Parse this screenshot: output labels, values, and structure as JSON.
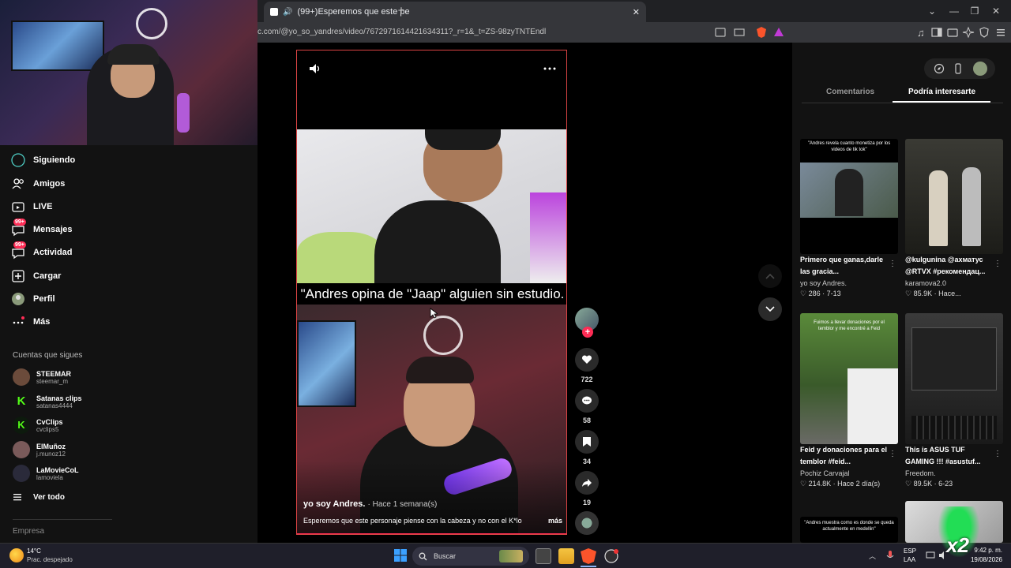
{
  "browser": {
    "tab_title": "(99+)Esperemos que este pe",
    "url": "c.com/@yo_so_yandres/video/7672971614421634311?_r=1&_t=ZS-98zyTNTEndl"
  },
  "sidebar": {
    "nav": [
      {
        "label": "Siguiendo",
        "icon": "following-icon"
      },
      {
        "label": "Amigos",
        "icon": "friends-icon"
      },
      {
        "label": "LIVE",
        "icon": "live-icon"
      },
      {
        "label": "Mensajes",
        "icon": "messages-icon",
        "badge": "99+"
      },
      {
        "label": "Actividad",
        "icon": "activity-icon",
        "badge": "99+"
      },
      {
        "label": "Cargar",
        "icon": "upload-icon"
      },
      {
        "label": "Perfil",
        "icon": "profile-avatar"
      },
      {
        "label": "Más",
        "icon": "more-icon"
      }
    ],
    "following_heading": "Cuentas que sigues",
    "accounts": [
      {
        "name": "STEEMAR",
        "handle": "steemar_m"
      },
      {
        "name": "Satanas clips",
        "handle": "satanas4444"
      },
      {
        "name": "CvClips",
        "handle": "cvclips5"
      },
      {
        "name": "ElMuñoz",
        "handle": "j.munoz12"
      },
      {
        "name": "LaMovieCoL",
        "handle": "lamoviela"
      }
    ],
    "see_all": "Ver todo",
    "company": "Empresa"
  },
  "video": {
    "caption_overlay": "\"Andres opina de \"Jaap\" alguien sin estudio.",
    "author": "yo soy Andres.",
    "time": "· Hace 1 semana(s)",
    "description": "Esperemos que este personaje piense con la cabeza y no con el K*lo",
    "more": "más",
    "likes": "722",
    "comments": "58",
    "saves": "34",
    "shares": "19"
  },
  "panel": {
    "tab_comments": "Comentarios",
    "tab_suggested": "Podría interesarte",
    "cards": [
      {
        "thumb_text": "\"Andres revela cuanto monetiza por los videos de tik tok\"",
        "title": "Primero que ganas,darle las gracia...",
        "author": "yo soy Andres.",
        "stats": "♡ 286 · 7-13"
      },
      {
        "thumb_text": "",
        "title": "@kulgunina @ахматус @RTVX #рекомендац...",
        "author": "karamova2.0",
        "stats": "♡ 85.9K · Hace..."
      },
      {
        "thumb_text": "Fuimos a llevar donaciones por el temblor y me encontré a Feid",
        "title": "Feid y donaciones para el temblor #feid...",
        "author": "Pochiz Carvajal",
        "stats": "♡ 214.8K · Hace 2 día(s)"
      },
      {
        "thumb_text": "",
        "title": "This is ASUS TUF GAMING !!! #asustuf...",
        "author": "Freedom.",
        "stats": "♡ 89.5K · 6-23"
      },
      {
        "thumb_text": "\"Andres muestra como es donde se queda actualmente en medellin\"",
        "title": "",
        "author": "",
        "stats": ""
      }
    ]
  },
  "taskbar": {
    "weather_temp": "14°C",
    "weather_desc": "Prac. despejado",
    "search_placeholder": "Buscar",
    "lang": "ESP",
    "lang2": "LAA",
    "time": "9:42 p. m.",
    "date": "19/08/2026",
    "overlay_badge": "x2"
  }
}
